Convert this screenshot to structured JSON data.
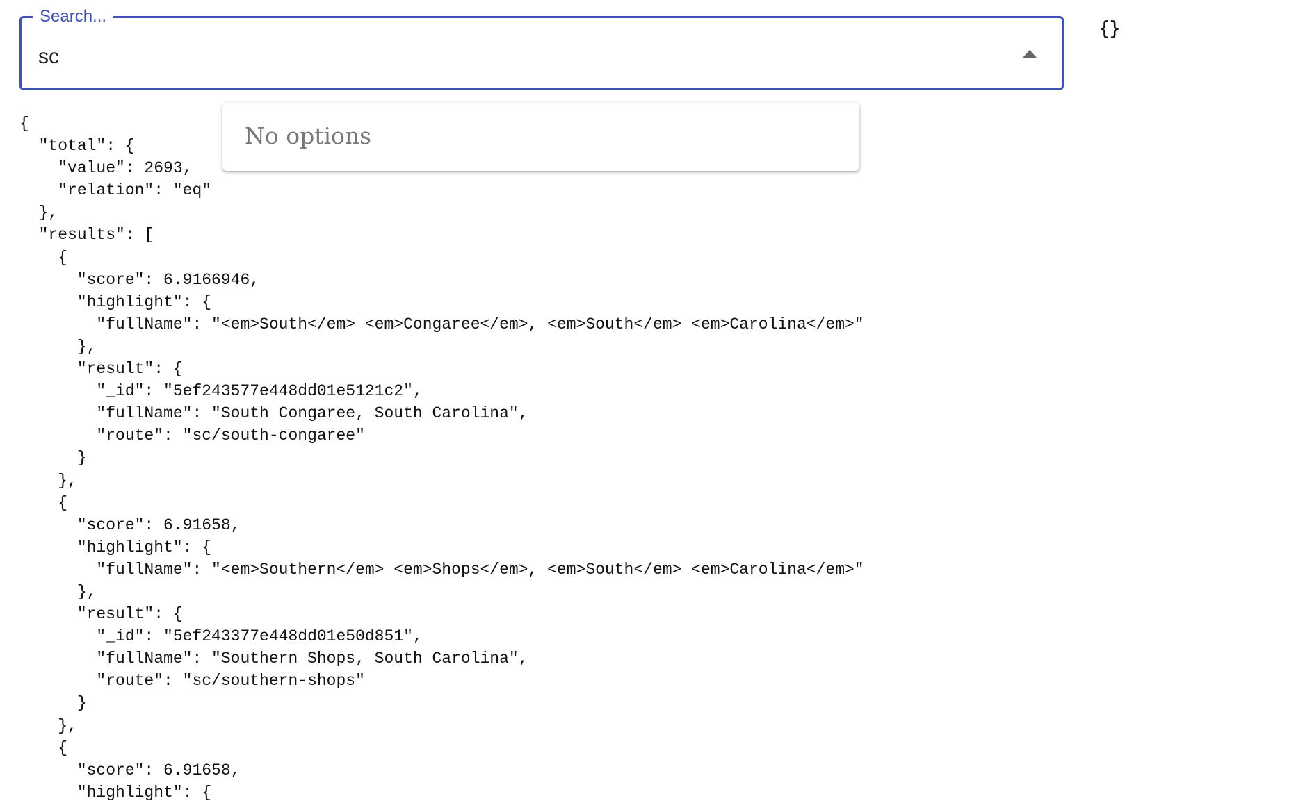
{
  "search": {
    "label": "Search...",
    "value": "sc"
  },
  "state_display": "{}",
  "dropdown": {
    "message": "No options"
  },
  "json_output": "{\n  \"total\": {\n    \"value\": 2693,\n    \"relation\": \"eq\"\n  },\n  \"results\": [\n    {\n      \"score\": 6.9166946,\n      \"highlight\": {\n        \"fullName\": \"<em>South</em> <em>Congaree</em>, <em>South</em> <em>Carolina</em>\"\n      },\n      \"result\": {\n        \"_id\": \"5ef243577e448dd01e5121c2\",\n        \"fullName\": \"South Congaree, South Carolina\",\n        \"route\": \"sc/south-congaree\"\n      }\n    },\n    {\n      \"score\": 6.91658,\n      \"highlight\": {\n        \"fullName\": \"<em>Southern</em> <em>Shops</em>, <em>South</em> <em>Carolina</em>\"\n      },\n      \"result\": {\n        \"_id\": \"5ef243377e448dd01e50d851\",\n        \"fullName\": \"Southern Shops, South Carolina\",\n        \"route\": \"sc/southern-shops\"\n      }\n    },\n    {\n      \"score\": 6.91658,\n      \"highlight\": {"
}
